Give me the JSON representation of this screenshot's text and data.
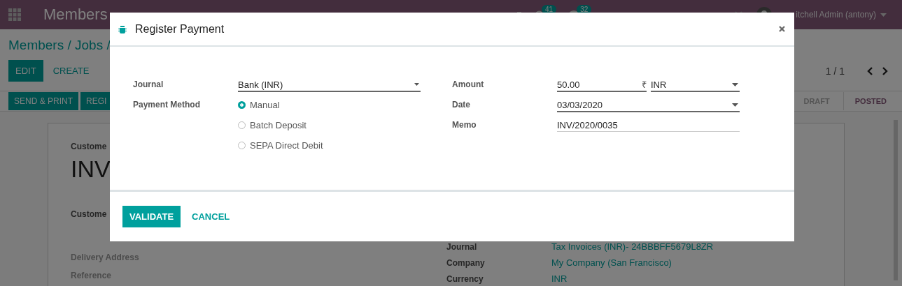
{
  "navbar": {
    "brand": "Members",
    "activity_count": "41",
    "message_count": "32",
    "user": "itchell Admin (antony)"
  },
  "breadcrumb": "Members / Jobs /",
  "main_buttons": [
    "EDIT",
    "CREATE"
  ],
  "pager": "1 / 1",
  "action_buttons": [
    "SEND & PRINT",
    "REGI"
  ],
  "status_stages": [
    {
      "label": "DRAFT",
      "selected": false
    },
    {
      "label": "POSTED",
      "selected": true
    }
  ],
  "sheet": {
    "customer_top_label": "Custome",
    "number": "INV",
    "customer_label": "Custome",
    "left_labels": [
      "Delivery Address",
      "Reference"
    ],
    "right_fields": [
      {
        "label": "Journal",
        "value": "Tax Invoices (INR)- 24BBBFF5679L8ZR"
      },
      {
        "label": "Company",
        "value": "My Company (San Francisco)"
      },
      {
        "label": "Currency",
        "value": "INR"
      }
    ]
  },
  "dialog": {
    "title": "Register Payment",
    "journal": {
      "label": "Journal",
      "value": "Bank (INR)"
    },
    "payment_method": {
      "label": "Payment Method",
      "options": [
        {
          "label": "Manual",
          "selected": true
        },
        {
          "label": "Batch Deposit",
          "selected": false
        },
        {
          "label": "SEPA Direct Debit",
          "selected": false
        }
      ]
    },
    "amount": {
      "label": "Amount",
      "value": "50.00",
      "symbol": "₹",
      "currency": "INR"
    },
    "date": {
      "label": "Date",
      "value": "03/03/2020"
    },
    "memo": {
      "label": "Memo",
      "value": "INV/2020/0035"
    },
    "buttons": [
      "VALIDATE",
      "CANCEL"
    ]
  }
}
